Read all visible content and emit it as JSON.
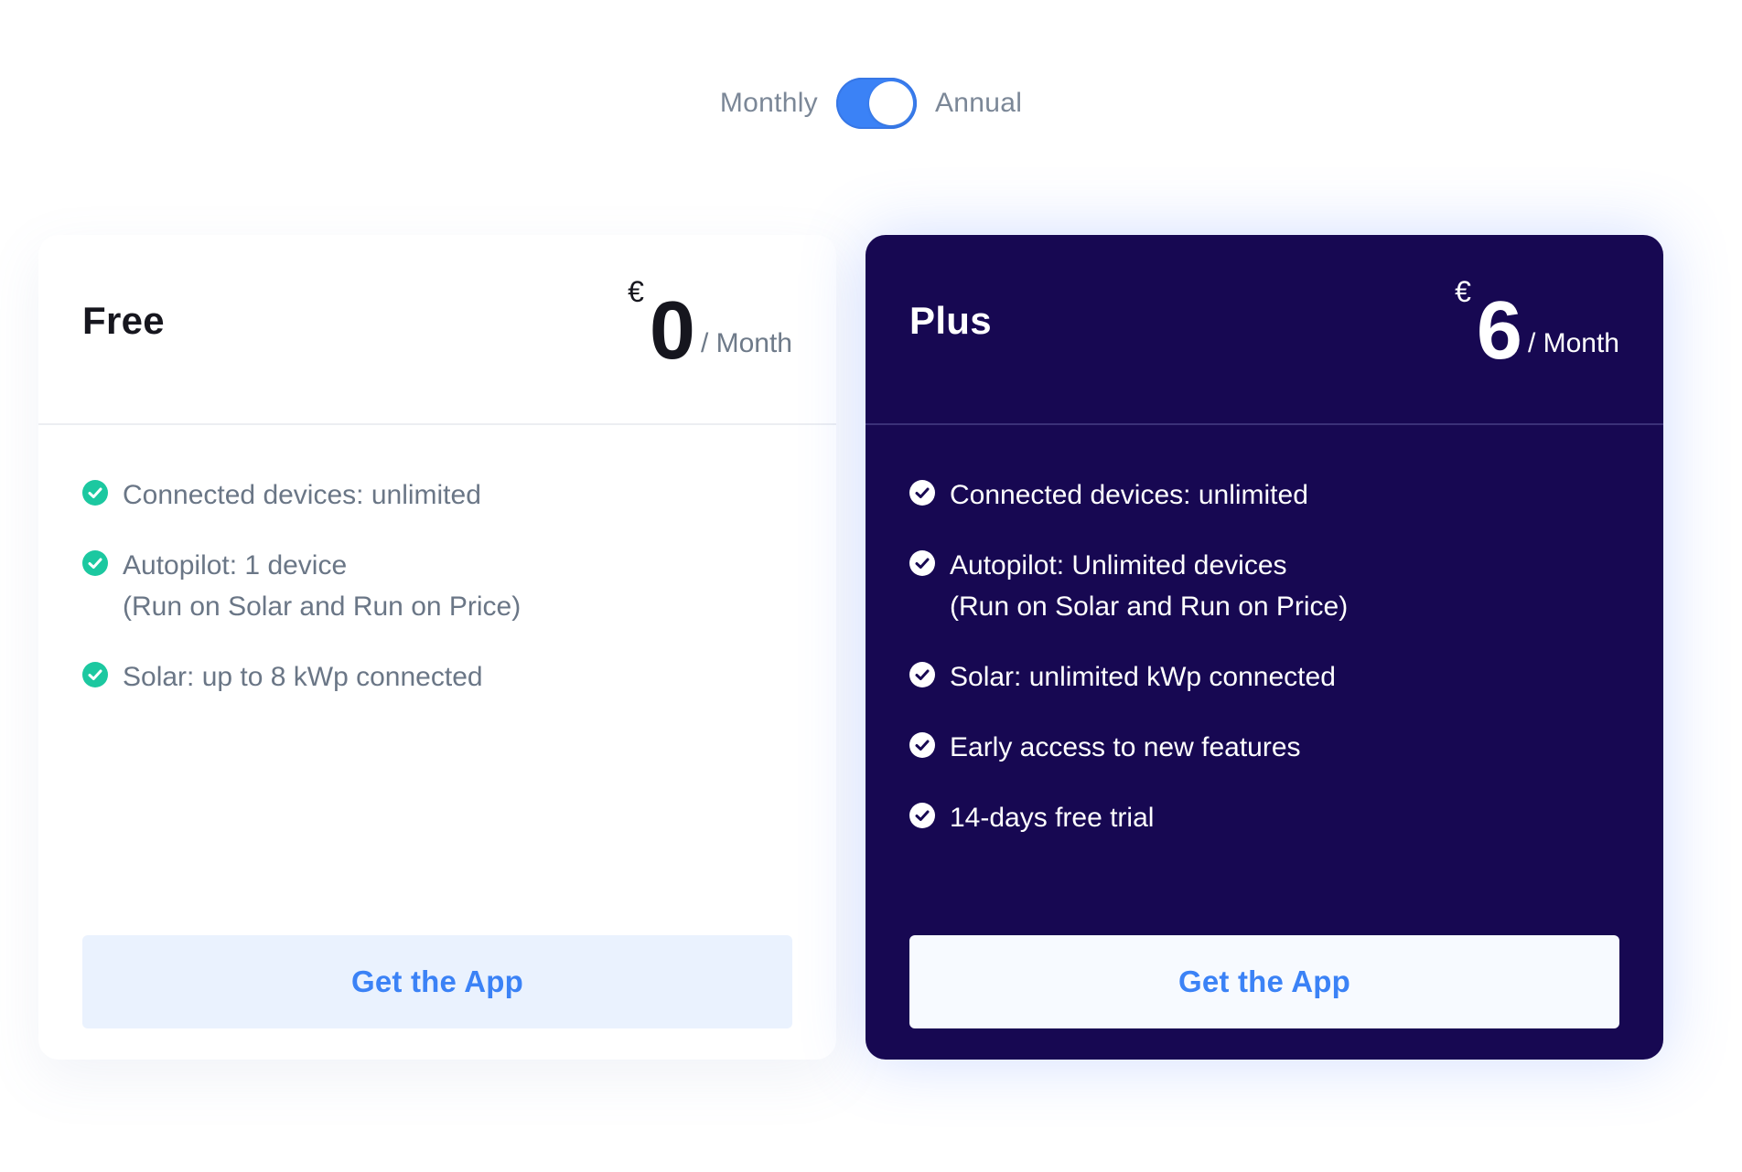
{
  "billing_toggle": {
    "monthly_label": "Monthly",
    "annual_label": "Annual",
    "selected": "Annual"
  },
  "colors": {
    "accent": "#3b82f6",
    "plus_card_bg": "#170852",
    "free_check": "#1cc8a0"
  },
  "plans": [
    {
      "name": "Free",
      "currency": "€",
      "price": "0",
      "period": "/ Month",
      "features": [
        "Connected devices: unlimited",
        "Autopilot: 1 device",
        "(Run on Solar and Run on Price)",
        "Solar: up to 8 kWp connected"
      ],
      "cta": "Get the App",
      "check_icon": "check-circle-icon"
    },
    {
      "name": "Plus",
      "currency": "€",
      "price": "6",
      "period": "/ Month",
      "features": [
        "Connected devices: unlimited",
        "Autopilot: Unlimited devices",
        "(Run on Solar and Run on Price)",
        "Solar: unlimited kWp connected",
        "Early access to new features",
        "14-days free trial"
      ],
      "cta": "Get the App",
      "check_icon": "check-circle-icon"
    }
  ]
}
